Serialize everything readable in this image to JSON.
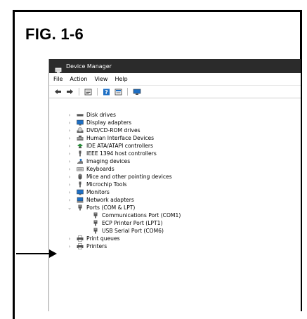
{
  "figure": {
    "label": "FIG. 1-6"
  },
  "window": {
    "title": "Device Manager",
    "menu": [
      "File",
      "Action",
      "View",
      "Help"
    ]
  },
  "toolbar": {
    "icons": [
      "back-arrow-icon",
      "forward-arrow-icon",
      "properties-icon",
      "help-icon",
      "update-driver-icon",
      "scan-monitor-icon"
    ]
  },
  "tree": {
    "categories": [
      {
        "label": "Disk drives",
        "icon": "disk-drive-icon",
        "expanded": false
      },
      {
        "label": "Display adapters",
        "icon": "display-adapter-icon",
        "expanded": false
      },
      {
        "label": "DVD/CD-ROM drives",
        "icon": "dvd-drive-icon",
        "expanded": false
      },
      {
        "label": "Human Interface Devices",
        "icon": "hid-icon",
        "expanded": false
      },
      {
        "label": "IDE ATA/ATAPI controllers",
        "icon": "ide-controller-icon",
        "expanded": false
      },
      {
        "label": "IEEE 1394 host controllers",
        "icon": "ieee1394-icon",
        "expanded": false
      },
      {
        "label": "Imaging devices",
        "icon": "camera-icon",
        "expanded": false
      },
      {
        "label": "Keyboards",
        "icon": "keyboard-icon",
        "expanded": false
      },
      {
        "label": "Mice and other pointing devices",
        "icon": "mouse-icon",
        "expanded": false
      },
      {
        "label": "Microchip Tools",
        "icon": "connector-icon",
        "expanded": false
      },
      {
        "label": "Monitors",
        "icon": "monitor-icon",
        "expanded": false
      },
      {
        "label": "Network adapters",
        "icon": "network-adapter-icon",
        "expanded": false
      },
      {
        "label": "Ports (COM & LPT)",
        "icon": "port-icon",
        "expanded": true
      },
      {
        "label": "Print queues",
        "icon": "printer-icon",
        "expanded": false
      },
      {
        "label": "Printers",
        "icon": "printer-icon",
        "expanded": false
      }
    ],
    "ports_children": [
      {
        "label": "Communications Port (COM1)",
        "icon": "port-icon"
      },
      {
        "label": "ECP Printer Port (LPT1)",
        "icon": "port-icon"
      },
      {
        "label": "USB Serial Port (COM6)",
        "icon": "port-icon"
      }
    ]
  },
  "colors": {
    "titlebar": "#2b2b2b",
    "accent": "#1e6fc4",
    "frame": "#000000"
  }
}
